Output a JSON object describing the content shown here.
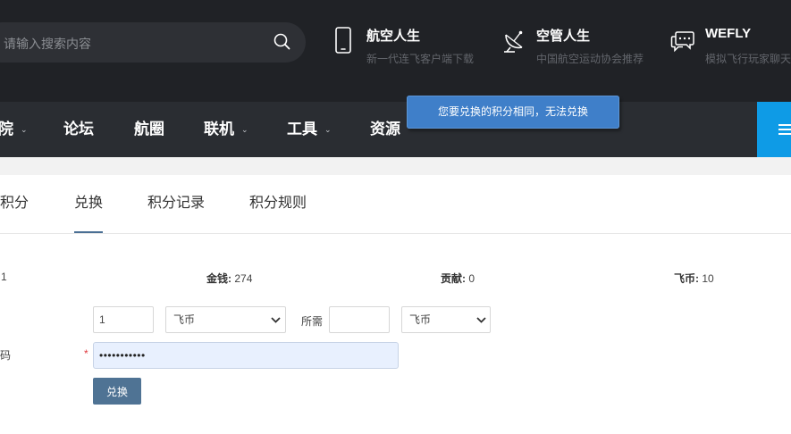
{
  "header": {
    "search": {
      "placeholder": "请输入搜索内容"
    },
    "promos": [
      {
        "title": "航空人生",
        "subtitle": "新一代连飞客户端下载",
        "icon": "mobile-phone-icon"
      },
      {
        "title": "空管人生",
        "subtitle": "中国航空运动协会推荐",
        "icon": "radar-dish-icon"
      },
      {
        "title": "WEFLY",
        "subtitle": "模拟飞行玩家聊天",
        "icon": "chat-bubbles-icon"
      }
    ]
  },
  "nav": {
    "items": [
      {
        "label": "院",
        "has_caret": true
      },
      {
        "label": "论坛",
        "has_caret": false
      },
      {
        "label": "航圈",
        "has_caret": false
      },
      {
        "label": "联机",
        "has_caret": true
      },
      {
        "label": "工具",
        "has_caret": true
      },
      {
        "label": "资源",
        "has_caret": false
      }
    ],
    "caret": "⌄"
  },
  "toast": {
    "message": "您要兑换的积分相同，无法兑换"
  },
  "tabs": [
    {
      "label": "积分",
      "active": false
    },
    {
      "label": "兑换",
      "active": true
    },
    {
      "label": "积分记录",
      "active": false
    },
    {
      "label": "积分规则",
      "active": false
    }
  ],
  "stats": [
    {
      "label": "",
      "value": "1"
    },
    {
      "label": "金钱:",
      "value": "274"
    },
    {
      "label": "贡献:",
      "value": "0"
    },
    {
      "label": "飞币:",
      "value": "10"
    }
  ],
  "form": {
    "amount_value": "1",
    "from_currency": "飞币",
    "required_label": "所需",
    "required_value": "",
    "to_currency": "飞币",
    "password_label": "密码",
    "required_mark": "*",
    "password_value": "•••••••••••",
    "submit_label": "兑换"
  },
  "colors": {
    "header_bg": "#202226",
    "nav_bg": "#2a2d32",
    "accent": "#0e9be6",
    "toast_bg": "#3f7fc9",
    "button_bg": "#4f7394",
    "required": "#e0393e"
  }
}
